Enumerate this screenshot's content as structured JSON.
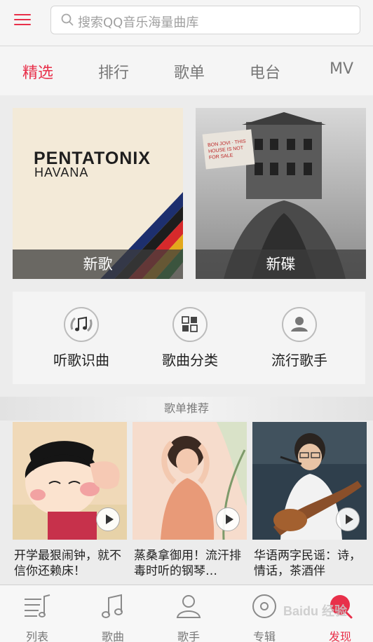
{
  "header": {
    "search_placeholder": "搜索QQ音乐海量曲库"
  },
  "tabs": [
    {
      "label": "精选",
      "active": true
    },
    {
      "label": "排行",
      "active": false
    },
    {
      "label": "歌单",
      "active": false
    },
    {
      "label": "电台",
      "active": false
    },
    {
      "label": "MV",
      "active": false
    }
  ],
  "features": {
    "left": {
      "caption": "新歌",
      "cover_title": "PENTATONIX",
      "cover_subtitle": "HAVANA"
    },
    "right": {
      "caption": "新碟",
      "cover_sticker": "BON JOVI · THIS HOUSE IS NOT FOR SALE"
    }
  },
  "quick_actions": [
    {
      "label": "听歌识曲",
      "icon": "music-note-icon"
    },
    {
      "label": "歌曲分类",
      "icon": "grid-icon"
    },
    {
      "label": "流行歌手",
      "icon": "person-icon"
    }
  ],
  "playlist_section": {
    "title": "歌单推荐",
    "items": [
      {
        "title": "开学最狠闹钟，就不信你还赖床！"
      },
      {
        "title": "蒸桑拿御用！流汗排毒时听的钢琴…"
      },
      {
        "title": "华语两字民谣：诗，情话，茶酒伴"
      }
    ]
  },
  "bottom_nav": [
    {
      "label": "列表",
      "icon": "list-icon",
      "active": false
    },
    {
      "label": "歌曲",
      "icon": "music-icon",
      "active": false
    },
    {
      "label": "歌手",
      "icon": "singer-icon",
      "active": false
    },
    {
      "label": "专辑",
      "icon": "album-icon",
      "active": false
    },
    {
      "label": "发现",
      "icon": "discover-icon",
      "active": true
    }
  ],
  "watermark": "Baidu 经验",
  "colors": {
    "accent": "#e8304a",
    "inactive": "#777777"
  }
}
